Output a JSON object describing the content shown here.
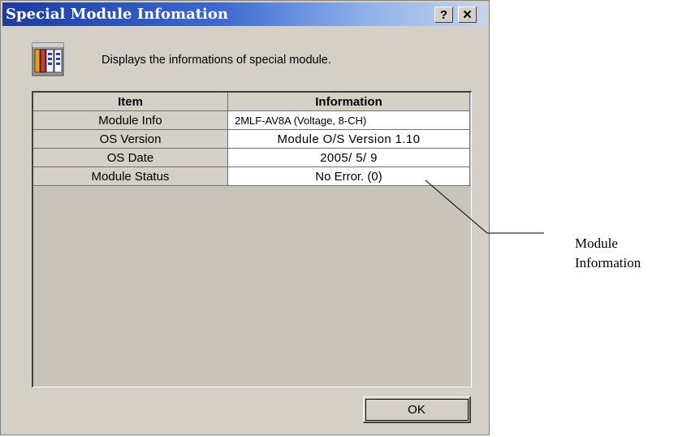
{
  "dialog": {
    "title": "Special Module Infomation",
    "help_label": "?",
    "close_label": "✕",
    "description": "Displays the informations of special module.",
    "ok_label": "OK"
  },
  "table": {
    "headers": [
      "Item",
      "Information"
    ],
    "rows": [
      {
        "item": "Module Info",
        "info": "2MLF-AV8A (Voltage, 8-CH)"
      },
      {
        "item": "OS Version",
        "info": "Module O/S Version  1.10"
      },
      {
        "item": "OS Date",
        "info": "2005/ 5/ 9"
      },
      {
        "item": "Module Status",
        "info": "No Error. (0)"
      }
    ]
  },
  "callout": {
    "line1": "Module",
    "line2": "Information"
  },
  "colors": {
    "title_gradient_start": "#1c3c9e",
    "title_gradient_end": "#c6d3ea",
    "dialog_face": "#d4d0c8"
  }
}
